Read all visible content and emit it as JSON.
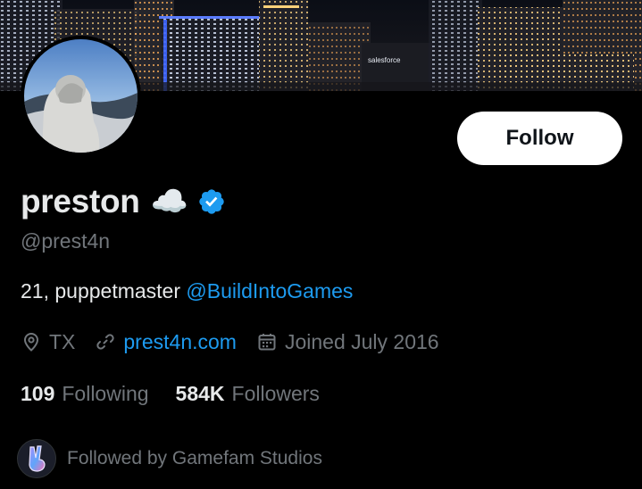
{
  "banner": {
    "sign_text": "salesforce"
  },
  "profile": {
    "display_name": "preston",
    "name_emoji": "☁️",
    "handle": "@prest4n",
    "bio_text": "21, puppetmaster ",
    "bio_mention": "@BuildIntoGames",
    "follow_label": "Follow"
  },
  "meta": {
    "location": "TX",
    "website": "prest4n.com",
    "joined": "Joined July 2016"
  },
  "stats": {
    "following_count": "109",
    "following_label": "Following",
    "followers_count": "584K",
    "followers_label": "Followers"
  },
  "followed_by": {
    "text": "Followed by Gamefam Studios"
  },
  "colors": {
    "background": "#000000",
    "accent": "#1d9bf0",
    "muted": "#71767b",
    "text": "#e7e9ea",
    "verified": "#1d9bf0"
  },
  "icons": {
    "verified": "verified-badge-icon",
    "location": "location-pin-icon",
    "link": "link-icon",
    "calendar": "calendar-icon"
  }
}
